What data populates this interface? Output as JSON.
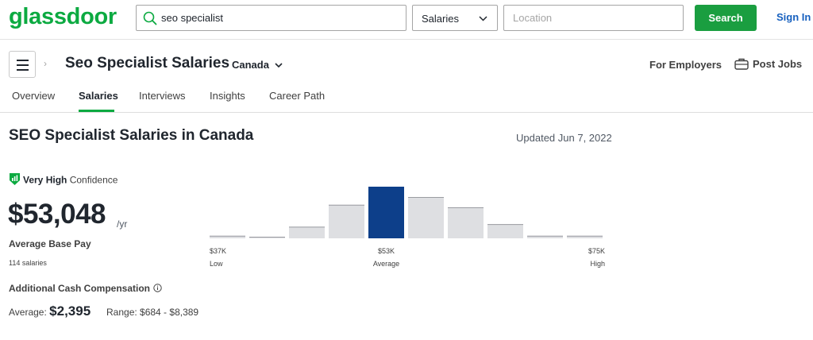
{
  "header": {
    "logo": "glassdoor",
    "search_value": "seo specialist",
    "category_select": "Salaries",
    "location_placeholder": "Location",
    "search_button": "Search",
    "signin": "Sign In"
  },
  "subheader": {
    "title": "Seo Specialist Salaries",
    "country": "Canada",
    "for_employers": "For Employers",
    "post_jobs": "Post Jobs"
  },
  "tabs": [
    {
      "label": "Overview",
      "active": false
    },
    {
      "label": "Salaries",
      "active": true
    },
    {
      "label": "Interviews",
      "active": false
    },
    {
      "label": "Insights",
      "active": false
    },
    {
      "label": "Career Path",
      "active": false
    }
  ],
  "main": {
    "heading": "SEO Specialist Salaries in Canada",
    "updated": "Updated Jun 7, 2022",
    "confidence_strong": "Very High",
    "confidence_rest": "Confidence",
    "amount": "$53,048",
    "per": "/yr",
    "avg_label": "Average Base Pay",
    "salaries_count": "114 salaries",
    "additional_label": "Additional Cash Compensation",
    "additional_avg_prefix": "Average:",
    "additional_avg_value": "$2,395",
    "additional_range": "Range: $684 - $8,389"
  },
  "colors": {
    "brand_green": "#0caa41",
    "button_green": "#1a9e40",
    "link_blue": "#1861bf",
    "bar_highlight": "#0d3f8a",
    "bar_gray": "#dedfe2"
  },
  "chart_data": {
    "type": "bar",
    "values": [
      1,
      0.5,
      4.5,
      13,
      20,
      16,
      12,
      5.5,
      1,
      1
    ],
    "highlight_index": 4,
    "ticks": [
      {
        "value": "$37K",
        "sub": "Low",
        "align": "start"
      },
      {
        "value": "$53K",
        "sub": "Average",
        "align": "middle"
      },
      {
        "value": "$75K",
        "sub": "High",
        "align": "end"
      }
    ]
  }
}
